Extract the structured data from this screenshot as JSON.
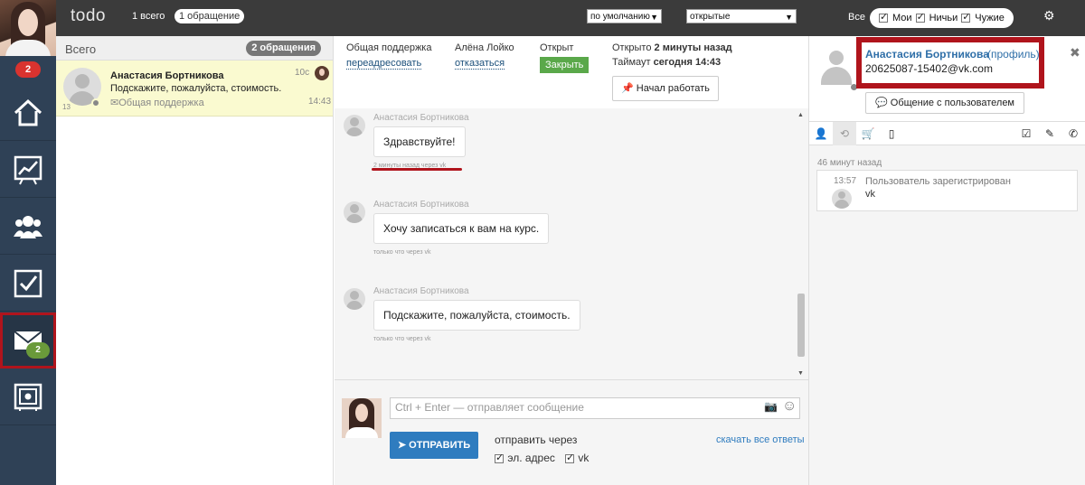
{
  "app": {
    "title": "todo",
    "count_all": "1 всего",
    "count_open_pill": "1 обращение"
  },
  "rail": {
    "badge": "2",
    "mail_badge": "2",
    "items": [
      "home-icon",
      "chart-icon",
      "users-icon",
      "tasks-icon",
      "mail-icon",
      "safe-icon"
    ]
  },
  "toolbar": {
    "sort_select": "по умолчанию",
    "status_select": "открытые",
    "all_label": "Все",
    "filters": [
      "Мои",
      "Ничьи",
      "Чужие"
    ]
  },
  "list": {
    "header": "Всего",
    "header_count": "2 обращения",
    "items": [
      {
        "name": "Анастасия Бортникова",
        "snippet": "Подскажите, пожалуйста, стоимость.",
        "queue": "Общая поддержка",
        "time_ago": "10с",
        "time": "14:43",
        "number": "13"
      }
    ]
  },
  "ticket": {
    "queue_label": "Общая поддержка",
    "queue_action": "переадресовать",
    "agent_label": "Алёна Лойко",
    "agent_action": "отказаться",
    "status_label": "Открыт",
    "close_button": "Закрыть",
    "opened_prefix": "Открыто",
    "opened_value": "2 минуты назад",
    "timeout_prefix": "Таймаут",
    "timeout_value": "сегодня 14:43",
    "start_button": "Начал работать"
  },
  "messages": [
    {
      "author": "Анастасия Бортникова",
      "text": "Здравствуйте!",
      "note": "2 минуты назад через vk"
    },
    {
      "author": "Анастасия Бортникова",
      "text": "Хочу записаться к вам на курс.",
      "note": "только что через vk"
    },
    {
      "author": "Анастасия Бортникова",
      "text": "Подскажите, пожалуйста, стоимость.",
      "note": "только что через vk"
    }
  ],
  "composer": {
    "placeholder": "Ctrl + Enter — отправляет сообщение",
    "send_button": "ОТПРАВИТЬ",
    "send_via": "отправить через",
    "opt_email": "эл. адрес",
    "opt_vk": "vk",
    "download_link": "скачать все ответы"
  },
  "user": {
    "name": "Анастасия Бортникова",
    "profile_link": "(профиль)",
    "email": "20625087-15402@vk.com",
    "chat_button": "Общение с пользователем",
    "tabs": [
      "user-icon",
      "history-icon",
      "cart-icon",
      "phone-device-icon",
      "checkbox-icon",
      "pencil-icon",
      "phone-icon"
    ]
  },
  "history": {
    "time_head": "46 минут назад",
    "events": [
      {
        "time": "13:57",
        "text": "Пользователь зарегистрирован",
        "source": "vk"
      }
    ]
  },
  "colors": {
    "rail": "#2f4156",
    "topbar": "#3b3b3b",
    "accent_blue": "#2f7cbf",
    "highlight_red": "#b0141c",
    "close_green": "#5aa84a"
  }
}
